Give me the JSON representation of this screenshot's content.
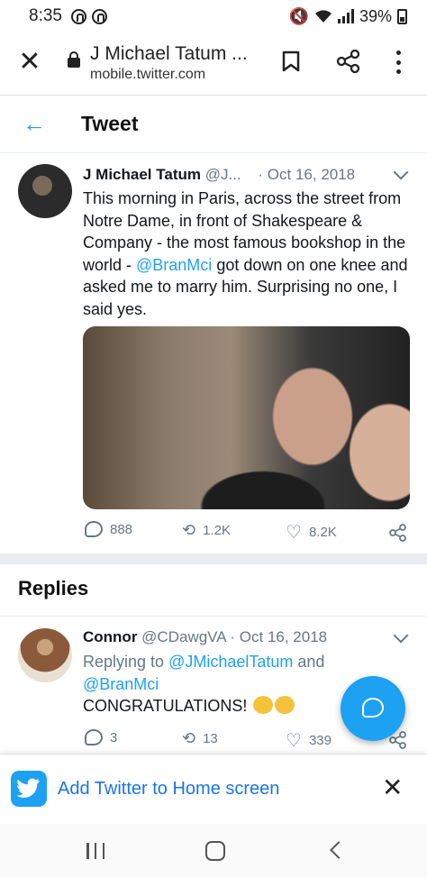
{
  "status_bar": {
    "time": "8:35",
    "battery": "39%"
  },
  "browser": {
    "page_title": "J Michael Tatum ...",
    "url": "mobile.twitter.com"
  },
  "header": {
    "title": "Tweet"
  },
  "tweet": {
    "author_name": "J Michael Tatum",
    "author_handle": "@J...",
    "date": "· Oct 16, 2018",
    "text_before": "This morning in Paris, across the street from Notre Dame, in front of Shakespeare & Company - the most famous bookshop in the world - ",
    "mention": "@BranMci",
    "text_after": " got down on one knee and asked me to marry him. Surprising no one, I said yes.",
    "replies": "888",
    "retweets": "1.2K",
    "likes": "8.2K"
  },
  "replies_section": {
    "title": "Replies"
  },
  "reply": {
    "author_name": "Connor",
    "author_handle": "@CDawgVA",
    "date": "· Oct 16, 2018",
    "replying_to_prefix": "Replying to ",
    "replying_to_user1": "@JMichaelTatum",
    "replying_to_and": " and",
    "replying_to_user2": "@BranMci",
    "text": "CONGRATULATIONS!",
    "replies": "3",
    "retweets": "13",
    "likes": "339"
  },
  "install_banner": {
    "label": "Add Twitter to Home screen"
  },
  "colors": {
    "twitter_blue": "#1da1f2",
    "link_blue": "#1a73e8",
    "muted": "#657786"
  },
  "icons": [
    "mute-icon",
    "wifi-icon",
    "signal-icon",
    "battery-icon",
    "close-icon",
    "lock-icon",
    "bookmark-icon",
    "share-icon",
    "more-icon",
    "back-arrow-icon",
    "chevron-down-icon",
    "reply-icon",
    "retweet-icon",
    "like-icon",
    "compose-reply-icon",
    "twitter-logo-icon"
  ]
}
